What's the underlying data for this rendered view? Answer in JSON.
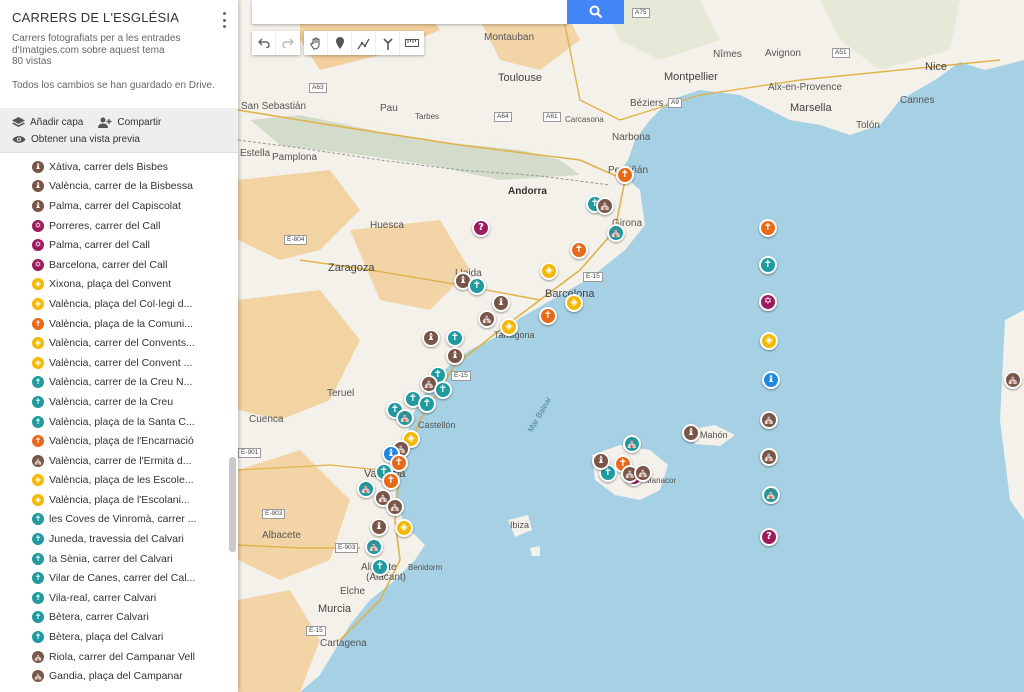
{
  "panel": {
    "title": "CARRERS DE L'ESGLÉSIA",
    "description": "Carrers fotografiats per a les entrades d'Imatgies.com sobre aquest tema",
    "views": "80 vistas",
    "save_status": "Todos los cambios se han guardado en Drive.",
    "add_layer": "Añadir capa",
    "share": "Compartir",
    "preview": "Obtener una vista previa"
  },
  "layers": [
    {
      "label": "Xàtiva, carrer dels Bisbes",
      "icon": "bishop-icon",
      "color": "#795548",
      "glyph": "♝"
    },
    {
      "label": "València, carrer de la Bisbessa",
      "icon": "bishop-icon",
      "color": "#795548",
      "glyph": "♝"
    },
    {
      "label": "Palma, carrer del Capiscolat",
      "icon": "bishop-icon",
      "color": "#795548",
      "glyph": "♝"
    },
    {
      "label": "Porreres, carrer del Call",
      "icon": "star-of-david-icon",
      "color": "#9c1b5c",
      "glyph": "✡"
    },
    {
      "label": "Palma, carrer del Call",
      "icon": "star-of-david-icon",
      "color": "#9c1b5c",
      "glyph": "✡"
    },
    {
      "label": "Barcelona, carrer del Call",
      "icon": "star-of-david-icon",
      "color": "#9c1b5c",
      "glyph": "✡"
    },
    {
      "label": "Xixona, plaça del Convent",
      "icon": "convent-icon",
      "color": "#f5b800",
      "glyph": "◈"
    },
    {
      "label": "València, plaça del Col·legi d...",
      "icon": "convent-icon",
      "color": "#f5b800",
      "glyph": "◈"
    },
    {
      "label": "València, plaça de la Comuni...",
      "icon": "cross-icon",
      "color": "#e8691a",
      "glyph": "✝"
    },
    {
      "label": "València, carrer del Convents...",
      "icon": "convent-icon",
      "color": "#f5b800",
      "glyph": "◈"
    },
    {
      "label": "València, carrer del Convent ...",
      "icon": "convent-icon",
      "color": "#f5b800",
      "glyph": "◈"
    },
    {
      "label": "València, carrer de la Creu N...",
      "icon": "cross-icon",
      "color": "#1e9aa0",
      "glyph": "✝"
    },
    {
      "label": "València, carrer de la Creu",
      "icon": "cross-icon",
      "color": "#1e9aa0",
      "glyph": "✝"
    },
    {
      "label": "València, plaça de la Santa C...",
      "icon": "cross-icon",
      "color": "#1e9aa0",
      "glyph": "✝"
    },
    {
      "label": "València, plaça de l'Encarnació",
      "icon": "cross-icon",
      "color": "#e8691a",
      "glyph": "✝"
    },
    {
      "label": "València, carrer de l'Ermita d...",
      "icon": "church-icon",
      "color": "#795548",
      "glyph": "⛪"
    },
    {
      "label": "València, plaça de les Escole...",
      "icon": "convent-icon",
      "color": "#f5b800",
      "glyph": "◈"
    },
    {
      "label": "València, plaça de l'Escolani...",
      "icon": "convent-icon",
      "color": "#f5b800",
      "glyph": "◈"
    },
    {
      "label": "les Coves de Vinromà, carrer ...",
      "icon": "cross-icon",
      "color": "#1e9aa0",
      "glyph": "✝"
    },
    {
      "label": "Juneda, travessia del Calvari",
      "icon": "cross-icon",
      "color": "#1e9aa0",
      "glyph": "✝"
    },
    {
      "label": "la Sènia, carrer del Calvari",
      "icon": "cross-icon",
      "color": "#1e9aa0",
      "glyph": "✝"
    },
    {
      "label": "Vilar de Canes, carrer del Cal...",
      "icon": "cross-icon",
      "color": "#1e9aa0",
      "glyph": "✝"
    },
    {
      "label": "Vila-real, carrer Calvari",
      "icon": "cross-icon",
      "color": "#1e9aa0",
      "glyph": "✝"
    },
    {
      "label": "Bètera, carrer Calvari",
      "icon": "cross-icon",
      "color": "#1e9aa0",
      "glyph": "✝"
    },
    {
      "label": "Bètera, plaça del Calvari",
      "icon": "cross-icon",
      "color": "#1e9aa0",
      "glyph": "✝"
    },
    {
      "label": "Riola, carrer del Campanar Vell",
      "icon": "bell-tower-icon",
      "color": "#795548",
      "glyph": "⛪"
    },
    {
      "label": "Gandia, plaça del Campanar",
      "icon": "bell-tower-icon",
      "color": "#795548",
      "glyph": "⛪"
    }
  ],
  "map": {
    "labels": {
      "montauban": "Montauban",
      "toulouse": "Toulouse",
      "montpellier": "Montpellier",
      "nimes": "Nîmes",
      "avignon": "Avignon",
      "nice": "Nice",
      "cannes": "Cannes",
      "aix": "Aix-en-Provence",
      "marseille": "Marsella",
      "toulon": "Tolón",
      "beziers": "Béziers",
      "narbonne": "Narbona",
      "carcassonne": "Carcasona",
      "tarbes": "Tarbes",
      "pau": "Pau",
      "sansebastian": "San Sebastián",
      "pamplona": "Pamplona",
      "andorra": "Andorra",
      "perpignan": "Perpiñán",
      "girona": "Girona",
      "huesca": "Huesca",
      "lleida": "Lleida",
      "zaragoza": "Zaragoza",
      "barcelona": "Barcelona",
      "tarragona": "Tarragona",
      "teruel": "Teruel",
      "castellon": "Castellón",
      "cuenca": "Cuenca",
      "valencia": "Valencia",
      "albacete": "Albacete",
      "alicante1": "Alicante",
      "alicante2": "(Alacant)",
      "benidorm": "Benidorm",
      "elche": "Elche",
      "murcia": "Murcia",
      "cartagena": "Cartagena",
      "ibiza": "Ibiza",
      "mahon": "Mahón",
      "manacor": "Manacor",
      "estella": "Estella",
      "sea": "Mar Balear"
    },
    "roads": [
      "A75",
      "A51",
      "A63",
      "A64",
      "A61",
      "A9",
      "E-804",
      "E-15",
      "E-15",
      "E-903",
      "E-903",
      "E-15",
      "E-901"
    ]
  },
  "markers": [
    {
      "color": "#e8691a",
      "glyph": "✝"
    },
    {
      "color": "#1e9aa0",
      "glyph": "✝"
    },
    {
      "color": "#795548",
      "glyph": "⛪"
    },
    {
      "color": "#1e9aa0",
      "glyph": "⛪"
    },
    {
      "color": "#e8691a",
      "glyph": "✝"
    },
    {
      "color": "#9c1b5c",
      "glyph": "?"
    },
    {
      "color": "#795548",
      "glyph": "♝"
    },
    {
      "color": "#1e9aa0",
      "glyph": "✝"
    },
    {
      "color": "#f5b800",
      "glyph": "◈"
    },
    {
      "color": "#795548",
      "glyph": "♝"
    },
    {
      "color": "#795548",
      "glyph": "⛪"
    },
    {
      "color": "#f5b800",
      "glyph": "◈"
    },
    {
      "color": "#f5b800",
      "glyph": "◈"
    },
    {
      "color": "#e8691a",
      "glyph": "✝"
    },
    {
      "color": "#795548",
      "glyph": "♝"
    },
    {
      "color": "#1e9aa0",
      "glyph": "✝"
    },
    {
      "color": "#795548",
      "glyph": "♝"
    },
    {
      "color": "#1e9aa0",
      "glyph": "✝"
    },
    {
      "color": "#795548",
      "glyph": "⛪"
    },
    {
      "color": "#1e9aa0",
      "glyph": "✝"
    },
    {
      "color": "#1e9aa0",
      "glyph": "✝"
    },
    {
      "color": "#1e9aa0",
      "glyph": "✝"
    },
    {
      "color": "#1e9aa0",
      "glyph": "✝"
    },
    {
      "color": "#1e9aa0",
      "glyph": "⛪"
    },
    {
      "color": "#f5b800",
      "glyph": "◈"
    },
    {
      "color": "#795548",
      "glyph": "⛪"
    },
    {
      "color": "#1e88e5",
      "glyph": "♝"
    },
    {
      "color": "#e8691a",
      "glyph": "✝"
    },
    {
      "color": "#1e9aa0",
      "glyph": "✝"
    },
    {
      "color": "#e8691a",
      "glyph": "✝"
    },
    {
      "color": "#1e9aa0",
      "glyph": "⛪"
    },
    {
      "color": "#795548",
      "glyph": "⛪"
    },
    {
      "color": "#795548",
      "glyph": "⛪"
    },
    {
      "color": "#795548",
      "glyph": "♝"
    },
    {
      "color": "#f5b800",
      "glyph": "◈"
    },
    {
      "color": "#1e9aa0",
      "glyph": "⛪"
    },
    {
      "color": "#1e9aa0",
      "glyph": "✝"
    },
    {
      "color": "#e8691a",
      "glyph": "✝"
    },
    {
      "color": "#1e9aa0",
      "glyph": "✝"
    },
    {
      "color": "#9c1b5c",
      "glyph": "✡"
    },
    {
      "color": "#f5b800",
      "glyph": "◈"
    },
    {
      "color": "#1e88e5",
      "glyph": "♝"
    },
    {
      "color": "#795548",
      "glyph": "♝"
    },
    {
      "color": "#795548",
      "glyph": "⛪"
    },
    {
      "color": "#1e9aa0",
      "glyph": "⛪"
    },
    {
      "color": "#9c1b5c",
      "glyph": "?"
    },
    {
      "color": "#795548",
      "glyph": "♝"
    },
    {
      "color": "#1e9aa0",
      "glyph": "⛪"
    },
    {
      "color": "#795548",
      "glyph": "⛪"
    },
    {
      "color": "#e8691a",
      "glyph": "✝"
    },
    {
      "color": "#1e9aa0",
      "glyph": "✝"
    },
    {
      "color": "#795548",
      "glyph": "⛪"
    },
    {
      "color": "#9c1b5c",
      "glyph": "✡"
    },
    {
      "color": "#795548",
      "glyph": "⛪"
    },
    {
      "color": "#795548",
      "glyph": "⛪"
    }
  ]
}
